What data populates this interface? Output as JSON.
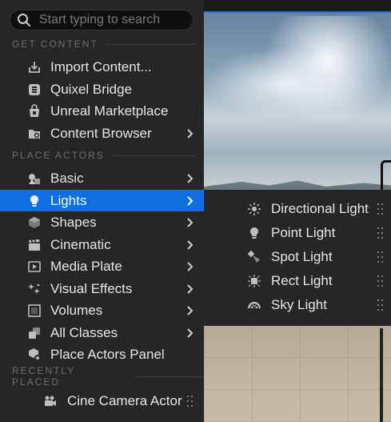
{
  "search": {
    "placeholder": "Start typing to search",
    "value": ""
  },
  "sections": {
    "get_content": "GET CONTENT",
    "place_actors": "PLACE ACTORS",
    "recently_placed": "RECENTLY PLACED"
  },
  "get_content_items": [
    {
      "label": "Import Content...",
      "icon": "import-icon"
    },
    {
      "label": "Quixel Bridge",
      "icon": "bridge-icon"
    },
    {
      "label": "Unreal Marketplace",
      "icon": "marketplace-icon"
    },
    {
      "label": "Content Browser",
      "icon": "folder-icon",
      "submenu": true
    }
  ],
  "place_actor_items": [
    {
      "label": "Basic",
      "icon": "basic-shapes-icon",
      "submenu": true
    },
    {
      "label": "Lights",
      "icon": "lightbulb-icon",
      "submenu": true,
      "active": true
    },
    {
      "label": "Shapes",
      "icon": "cube-icon",
      "submenu": true
    },
    {
      "label": "Cinematic",
      "icon": "clapperboard-icon",
      "submenu": true
    },
    {
      "label": "Media Plate",
      "icon": "media-plate-icon",
      "submenu": true
    },
    {
      "label": "Visual Effects",
      "icon": "sparkles-icon",
      "submenu": true
    },
    {
      "label": "Volumes",
      "icon": "volume-icon",
      "submenu": true
    },
    {
      "label": "All Classes",
      "icon": "classes-icon",
      "submenu": true
    },
    {
      "label": "Place Actors Panel",
      "icon": "place-actors-icon"
    }
  ],
  "recently_placed_items": [
    {
      "label": "Cine Camera Actor",
      "icon": "camera-icon"
    }
  ],
  "lights_submenu": [
    {
      "label": "Directional Light",
      "icon": "sun-icon"
    },
    {
      "label": "Point Light",
      "icon": "lightbulb-icon"
    },
    {
      "label": "Spot Light",
      "icon": "spotlight-icon"
    },
    {
      "label": "Rect Light",
      "icon": "rect-light-icon"
    },
    {
      "label": "Sky Light",
      "icon": "sky-light-icon"
    }
  ],
  "colors": {
    "accent": "#0f6ee0",
    "menu_bg": "#262626",
    "search_bg": "#0f0f0f"
  }
}
